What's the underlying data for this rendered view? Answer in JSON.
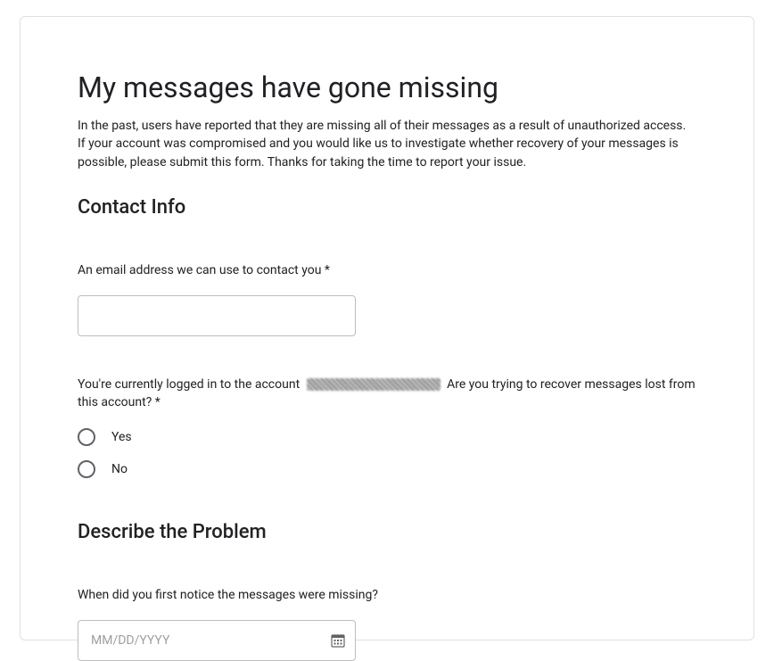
{
  "page": {
    "title": "My messages have gone missing",
    "intro": "In the past, users have reported that they are missing all of their messages as a result of unauthorized access. If your account was compromised and you would like us to investigate whether recovery of your messages is possible, please submit this form. Thanks for taking the time to report your issue."
  },
  "contact_section": {
    "heading": "Contact Info",
    "email_label": "An email address we can use to contact you *",
    "account_question_prefix": "You're currently logged in to the account ",
    "account_question_suffix": " Are you trying to recover messages lost from this account? *",
    "yes_label": "Yes",
    "no_label": "No"
  },
  "problem_section": {
    "heading": "Describe the Problem",
    "date_label": "When did you first notice the messages were missing?",
    "date_placeholder": "MM/DD/YYYY"
  }
}
